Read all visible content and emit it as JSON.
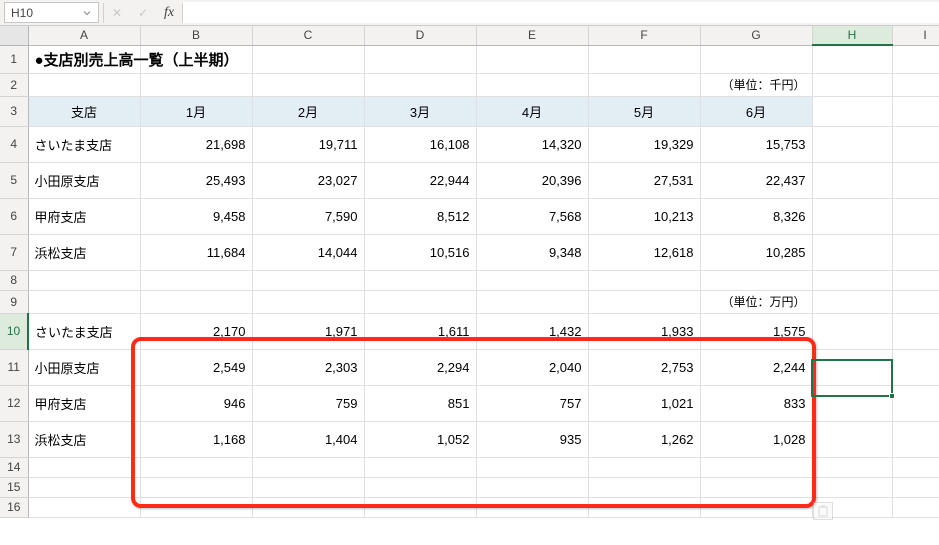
{
  "formula_bar": {
    "name_box": "H10",
    "cancel_glyph": "✕",
    "enter_glyph": "✓",
    "fx_label": "fx",
    "formula_value": ""
  },
  "columns": [
    "A",
    "B",
    "C",
    "D",
    "E",
    "F",
    "G",
    "H",
    "I"
  ],
  "rows_visible": [
    "1",
    "2",
    "3",
    "4",
    "5",
    "6",
    "7",
    "8",
    "9",
    "10",
    "11",
    "12",
    "13",
    "14",
    "15",
    "16"
  ],
  "active_cell": "H10",
  "title": "●支店別売上高一覧（上半期）",
  "unit1": "（単位：千円）",
  "unit2": "（単位：万円）",
  "header": {
    "store": "支店",
    "m1": "1月",
    "m2": "2月",
    "m3": "3月",
    "m4": "4月",
    "m5": "5月",
    "m6": "6月"
  },
  "branches": {
    "saitama": "さいたま支店",
    "odawara": "小田原支店",
    "kofu": "甲府支店",
    "hamamatsu": "浜松支店"
  },
  "sen": {
    "saitama": {
      "m1": "21,698",
      "m2": "19,711",
      "m3": "16,108",
      "m4": "14,320",
      "m5": "19,329",
      "m6": "15,753"
    },
    "odawara": {
      "m1": "25,493",
      "m2": "23,027",
      "m3": "22,944",
      "m4": "20,396",
      "m5": "27,531",
      "m6": "22,437"
    },
    "kofu": {
      "m1": "9,458",
      "m2": "7,590",
      "m3": "8,512",
      "m4": "7,568",
      "m5": "10,213",
      "m6": "8,326"
    },
    "hamamatsu": {
      "m1": "11,684",
      "m2": "14,044",
      "m3": "10,516",
      "m4": "9,348",
      "m5": "12,618",
      "m6": "10,285"
    }
  },
  "man": {
    "saitama": {
      "m1": "2,170",
      "m2": "1,971",
      "m3": "1,611",
      "m4": "1,432",
      "m5": "1,933",
      "m6": "1,575"
    },
    "odawara": {
      "m1": "2,549",
      "m2": "2,303",
      "m3": "2,294",
      "m4": "2,040",
      "m5": "2,753",
      "m6": "2,244"
    },
    "kofu": {
      "m1": "946",
      "m2": "759",
      "m3": "851",
      "m4": "757",
      "m5": "1,021",
      "m6": "833"
    },
    "hamamatsu": {
      "m1": "1,168",
      "m2": "1,404",
      "m3": "1,052",
      "m4": "935",
      "m5": "1,262",
      "m6": "1,028"
    }
  }
}
